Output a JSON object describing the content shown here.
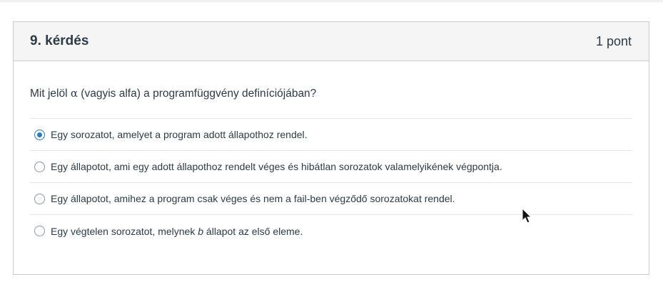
{
  "question": {
    "title": "9. kérdés",
    "points": "1 pont",
    "text_before": "Mit jelöl ",
    "text_symbol": "α",
    "text_after": " (vagyis alfa) a programfüggvény definíciójában?"
  },
  "answers": [
    {
      "text": "Egy sorozatot, amelyet a program adott állapothoz rendel.",
      "selected": true
    },
    {
      "text": "Egy állapotot, ami egy adott állapothoz rendelt véges és hibátlan sorozatok valamelyikének végpontja.",
      "selected": false
    },
    {
      "text": "Egy állapotot, amihez a program csak véges és nem a fail-ben végződő sorozatokat rendel.",
      "selected": false
    },
    {
      "text_before": "Egy végtelen sorozatot, melynek ",
      "text_italic": "b",
      "text_after": " állapot az első eleme.",
      "selected": false
    }
  ],
  "colors": {
    "accent": "#2b7abc",
    "header_bg": "#f5f5f5",
    "border": "#c7cdd1",
    "text": "#2d3b45"
  },
  "icons": {
    "cursor": "mouse-pointer-icon"
  }
}
